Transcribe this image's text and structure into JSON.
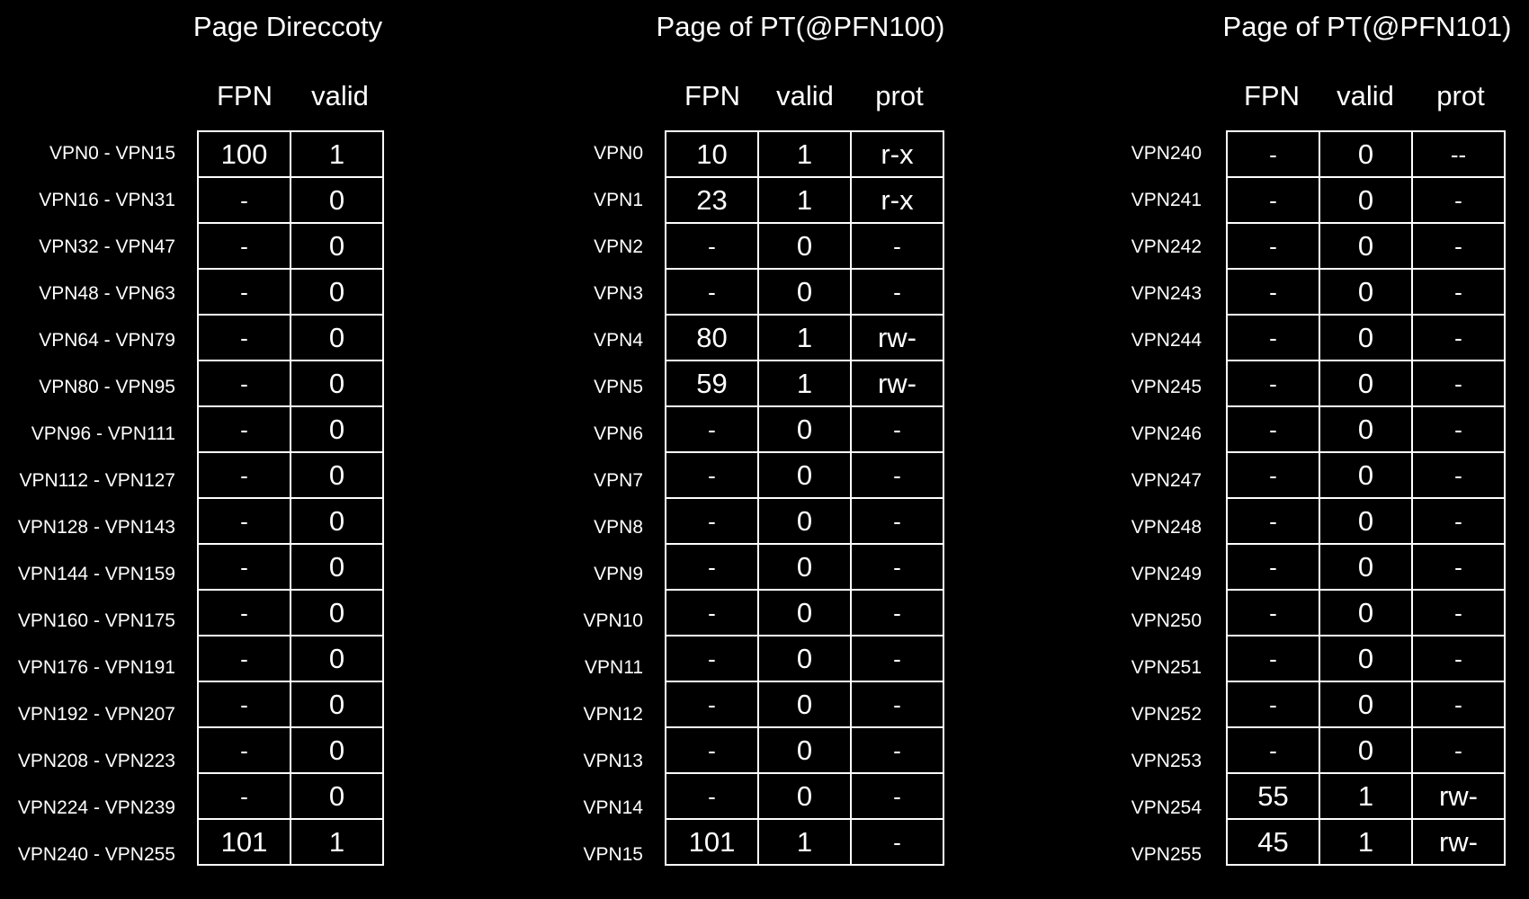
{
  "colors": {
    "background": "#000000",
    "foreground": "#ffffff"
  },
  "page_directory": {
    "title": "Page Direccoty",
    "headers": [
      "FPN",
      "valid"
    ],
    "rows": [
      {
        "label": "VPN0 - VPN15",
        "fpn": "100",
        "valid": "1"
      },
      {
        "label": "VPN16 - VPN31",
        "fpn": "-",
        "valid": "0"
      },
      {
        "label": "VPN32 - VPN47",
        "fpn": "-",
        "valid": "0"
      },
      {
        "label": "VPN48 - VPN63",
        "fpn": "-",
        "valid": "0"
      },
      {
        "label": "VPN64 - VPN79",
        "fpn": "-",
        "valid": "0"
      },
      {
        "label": "VPN80 - VPN95",
        "fpn": "-",
        "valid": "0"
      },
      {
        "label": "VPN96 - VPN111",
        "fpn": "-",
        "valid": "0"
      },
      {
        "label": "VPN112 - VPN127",
        "fpn": "-",
        "valid": "0"
      },
      {
        "label": "VPN128 - VPN143",
        "fpn": "-",
        "valid": "0"
      },
      {
        "label": "VPN144 - VPN159",
        "fpn": "-",
        "valid": "0"
      },
      {
        "label": "VPN160 - VPN175",
        "fpn": "-",
        "valid": "0"
      },
      {
        "label": "VPN176 - VPN191",
        "fpn": "-",
        "valid": "0"
      },
      {
        "label": "VPN192 - VPN207",
        "fpn": "-",
        "valid": "0"
      },
      {
        "label": "VPN208 - VPN223",
        "fpn": "-",
        "valid": "0"
      },
      {
        "label": "VPN224 - VPN239",
        "fpn": "-",
        "valid": "0"
      },
      {
        "label": "VPN240 - VPN255",
        "fpn": "101",
        "valid": "1"
      }
    ]
  },
  "page_table_100": {
    "title": "Page of PT(@PFN100)",
    "headers": [
      "FPN",
      "valid",
      "prot"
    ],
    "rows": [
      {
        "label": "VPN0",
        "fpn": "10",
        "valid": "1",
        "prot": "r-x"
      },
      {
        "label": "VPN1",
        "fpn": "23",
        "valid": "1",
        "prot": "r-x"
      },
      {
        "label": "VPN2",
        "fpn": "-",
        "valid": "0",
        "prot": "-"
      },
      {
        "label": "VPN3",
        "fpn": "-",
        "valid": "0",
        "prot": "-"
      },
      {
        "label": "VPN4",
        "fpn": "80",
        "valid": "1",
        "prot": "rw-"
      },
      {
        "label": "VPN5",
        "fpn": "59",
        "valid": "1",
        "prot": "rw-"
      },
      {
        "label": "VPN6",
        "fpn": "-",
        "valid": "0",
        "prot": "-"
      },
      {
        "label": "VPN7",
        "fpn": "-",
        "valid": "0",
        "prot": "-"
      },
      {
        "label": "VPN8",
        "fpn": "-",
        "valid": "0",
        "prot": "-"
      },
      {
        "label": "VPN9",
        "fpn": "-",
        "valid": "0",
        "prot": "-"
      },
      {
        "label": "VPN10",
        "fpn": "-",
        "valid": "0",
        "prot": "-"
      },
      {
        "label": "VPN11",
        "fpn": "-",
        "valid": "0",
        "prot": "-"
      },
      {
        "label": "VPN12",
        "fpn": "-",
        "valid": "0",
        "prot": "-"
      },
      {
        "label": "VPN13",
        "fpn": "-",
        "valid": "0",
        "prot": "-"
      },
      {
        "label": "VPN14",
        "fpn": "-",
        "valid": "0",
        "prot": "-"
      },
      {
        "label": "VPN15",
        "fpn": "101",
        "valid": "1",
        "prot": "-"
      }
    ]
  },
  "page_table_101": {
    "title": "Page of PT(@PFN101)",
    "headers": [
      "FPN",
      "valid",
      "prot"
    ],
    "rows": [
      {
        "label": "VPN240",
        "fpn": "-",
        "valid": "0",
        "prot": "--"
      },
      {
        "label": "VPN241",
        "fpn": "-",
        "valid": "0",
        "prot": "-"
      },
      {
        "label": "VPN242",
        "fpn": "-",
        "valid": "0",
        "prot": "-"
      },
      {
        "label": "VPN243",
        "fpn": "-",
        "valid": "0",
        "prot": "-"
      },
      {
        "label": "VPN244",
        "fpn": "-",
        "valid": "0",
        "prot": "-"
      },
      {
        "label": "VPN245",
        "fpn": "-",
        "valid": "0",
        "prot": "-"
      },
      {
        "label": "VPN246",
        "fpn": "-",
        "valid": "0",
        "prot": "-"
      },
      {
        "label": "VPN247",
        "fpn": "-",
        "valid": "0",
        "prot": "-"
      },
      {
        "label": "VPN248",
        "fpn": "-",
        "valid": "0",
        "prot": "-"
      },
      {
        "label": "VPN249",
        "fpn": "-",
        "valid": "0",
        "prot": "-"
      },
      {
        "label": "VPN250",
        "fpn": "-",
        "valid": "0",
        "prot": "-"
      },
      {
        "label": "VPN251",
        "fpn": "-",
        "valid": "0",
        "prot": "-"
      },
      {
        "label": "VPN252",
        "fpn": "-",
        "valid": "0",
        "prot": "-"
      },
      {
        "label": "VPN253",
        "fpn": "-",
        "valid": "0",
        "prot": "-"
      },
      {
        "label": "VPN254",
        "fpn": "55",
        "valid": "1",
        "prot": "rw-"
      },
      {
        "label": "VPN255",
        "fpn": "45",
        "valid": "1",
        "prot": "rw-"
      }
    ]
  }
}
